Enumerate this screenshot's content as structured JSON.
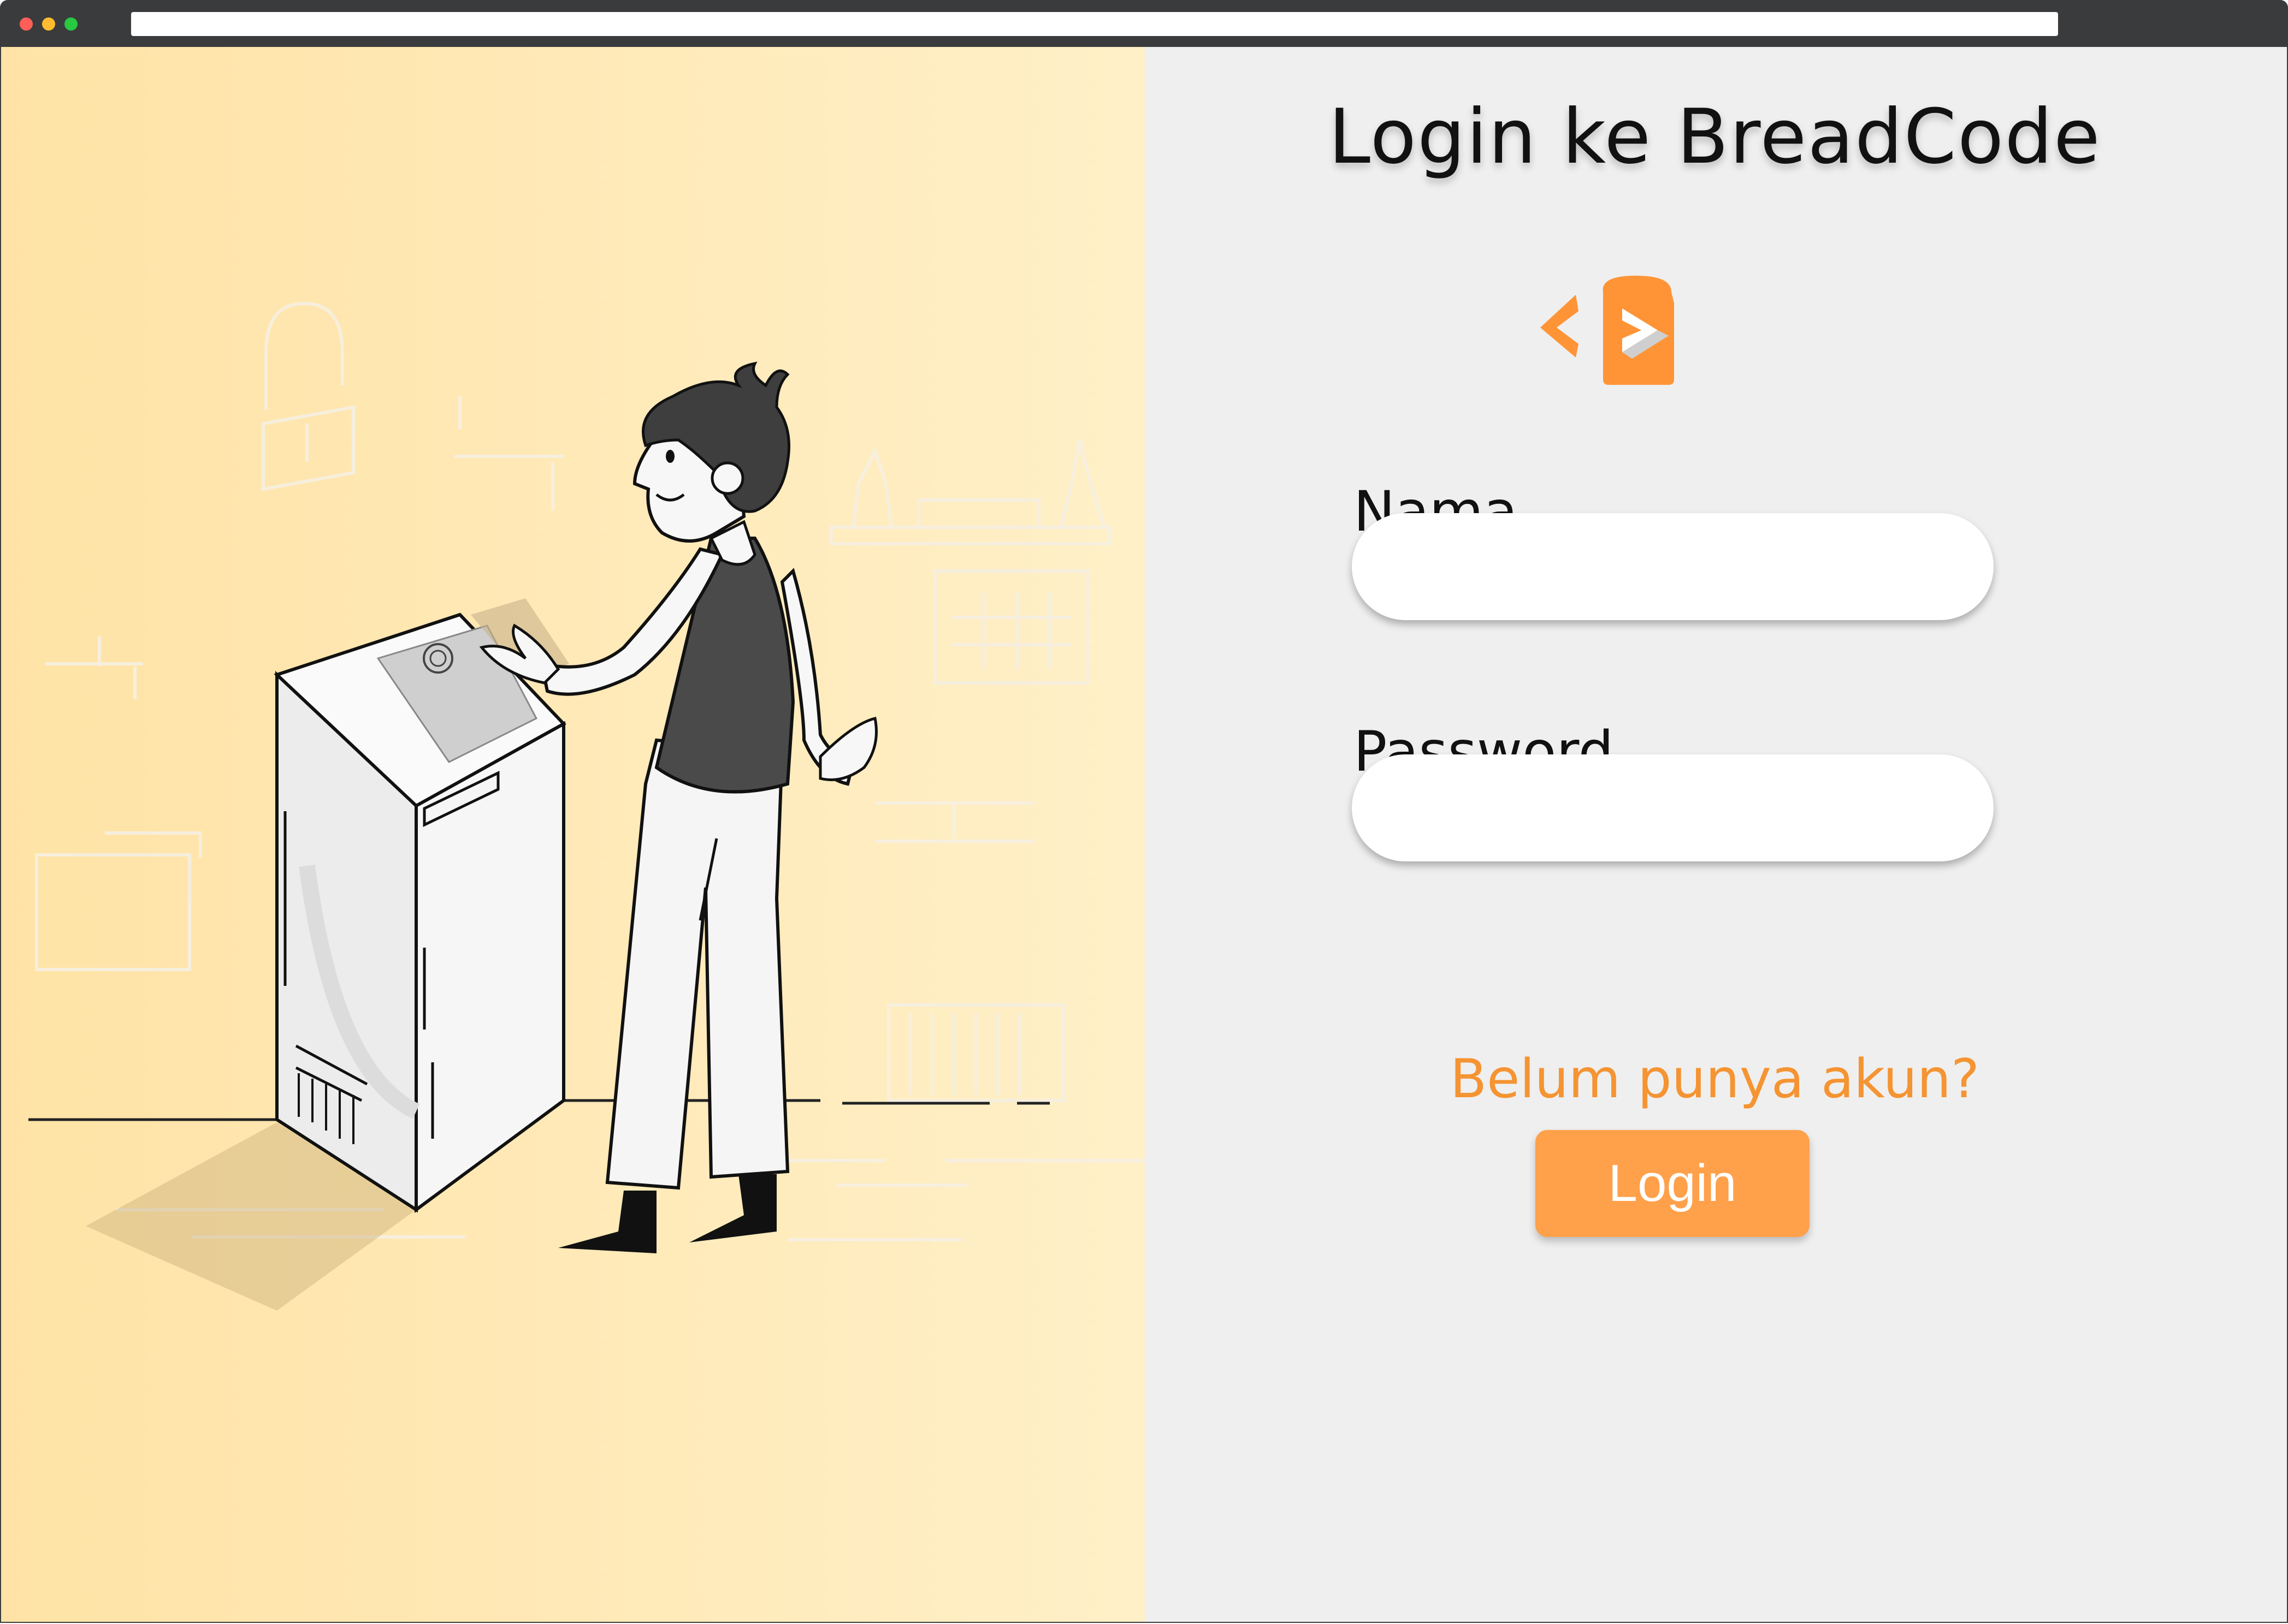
{
  "browser": {
    "url": ""
  },
  "login": {
    "title": "Login ke BreadCode",
    "name_label": "Nama",
    "name_value": "",
    "password_label": "Password",
    "password_value": "",
    "signup_link": "Belum punya akun?",
    "login_button": "Login"
  },
  "colors": {
    "accent": "#ffa04a",
    "link": "#f59432",
    "left_bg": "#ffe9b7",
    "right_bg": "#efefef",
    "chrome": "#3a3b3d"
  },
  "icons": {
    "logo": "breadcode-logo",
    "illustration": "man-fingerprint-scanner-illustration"
  }
}
